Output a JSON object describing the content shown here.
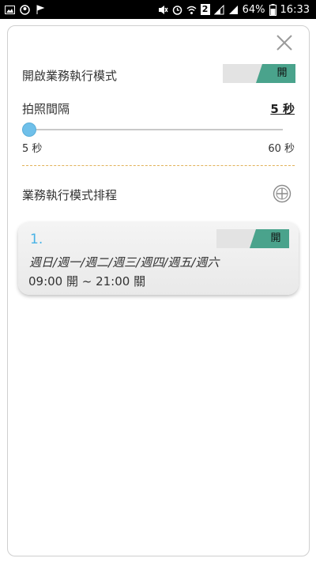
{
  "status_bar": {
    "battery_percent": "64%",
    "time": "16:33",
    "sim_badge": "2",
    "left_icons": [
      "image-icon",
      "circle-icon",
      "flag-icon"
    ],
    "right_icons": [
      "mute-icon",
      "alarm-icon",
      "wifi-icon",
      "sim-badge",
      "signal-icon",
      "signal-icon",
      "battery-icon"
    ]
  },
  "settings": {
    "business_mode_label": "開啟業務執行模式",
    "business_mode_toggle": "開",
    "business_mode_on": true,
    "interval_label": "拍照間隔",
    "interval_value": "5 秒",
    "slider": {
      "min_label": "5 秒",
      "max_label": "60 秒",
      "min": 5,
      "max": 60,
      "value": 5
    },
    "schedule_label": "業務執行模式排程"
  },
  "schedules": [
    {
      "index": "1.",
      "toggle": "開",
      "enabled": true,
      "days": "週日/週一/週二/週三/週四/週五/週六",
      "time": "09:00 開 ~ 21:00 關"
    }
  ],
  "colors": {
    "toggle_on": "#4aa38c",
    "toggle_track": "#e3e3e3",
    "slider_thumb": "#6fc0ea",
    "index_blue": "#49b3e6",
    "divider": "#e2b25a"
  }
}
